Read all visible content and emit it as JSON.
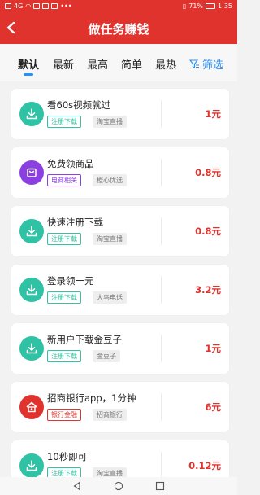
{
  "status_bar": {
    "carrier_signal": "4G",
    "battery": "71%",
    "time": "1:35"
  },
  "header": {
    "title": "做任务赚钱"
  },
  "tabs": [
    {
      "label": "默认",
      "active": true
    },
    {
      "label": "最新",
      "active": false
    },
    {
      "label": "最高",
      "active": false
    },
    {
      "label": "简单",
      "active": false
    },
    {
      "label": "最热",
      "active": false
    }
  ],
  "filter": {
    "label": "筛选",
    "icon": "filter-icon"
  },
  "colors": {
    "brand_red": "#e0332e",
    "teal": "#2fc2a5",
    "purple": "#8b3fe0",
    "blue": "#2a8ff7"
  },
  "tasks": [
    {
      "name": "看60s视频就过",
      "tag": "注册下载",
      "tag_color": "teal",
      "platform": "淘宝直播",
      "reward": "1元",
      "icon": "download-icon"
    },
    {
      "name": "免费领商品",
      "tag": "电商相关",
      "tag_color": "purple",
      "platform": "橙心优选",
      "reward": "0.8元",
      "icon": "shopping-bag-icon"
    },
    {
      "name": "快速注册下载",
      "tag": "注册下载",
      "tag_color": "teal",
      "platform": "淘宝直播",
      "reward": "0.8元",
      "icon": "download-icon"
    },
    {
      "name": "登录领一元",
      "tag": "注册下载",
      "tag_color": "teal",
      "platform": "大鸟电话",
      "reward": "3.2元",
      "icon": "download-icon"
    },
    {
      "name": "新用户下载金豆子",
      "tag": "注册下载",
      "tag_color": "teal",
      "platform": "金豆子",
      "reward": "1元",
      "icon": "download-icon"
    },
    {
      "name": "招商银行app，1分钟",
      "tag": "银行金融",
      "tag_color": "red",
      "platform": "招商银行",
      "reward": "6元",
      "icon": "bank-icon"
    },
    {
      "name": "10秒即可",
      "tag": "注册下载",
      "tag_color": "teal",
      "platform": "淘宝直播",
      "reward": "0.12元",
      "icon": "download-icon"
    }
  ]
}
